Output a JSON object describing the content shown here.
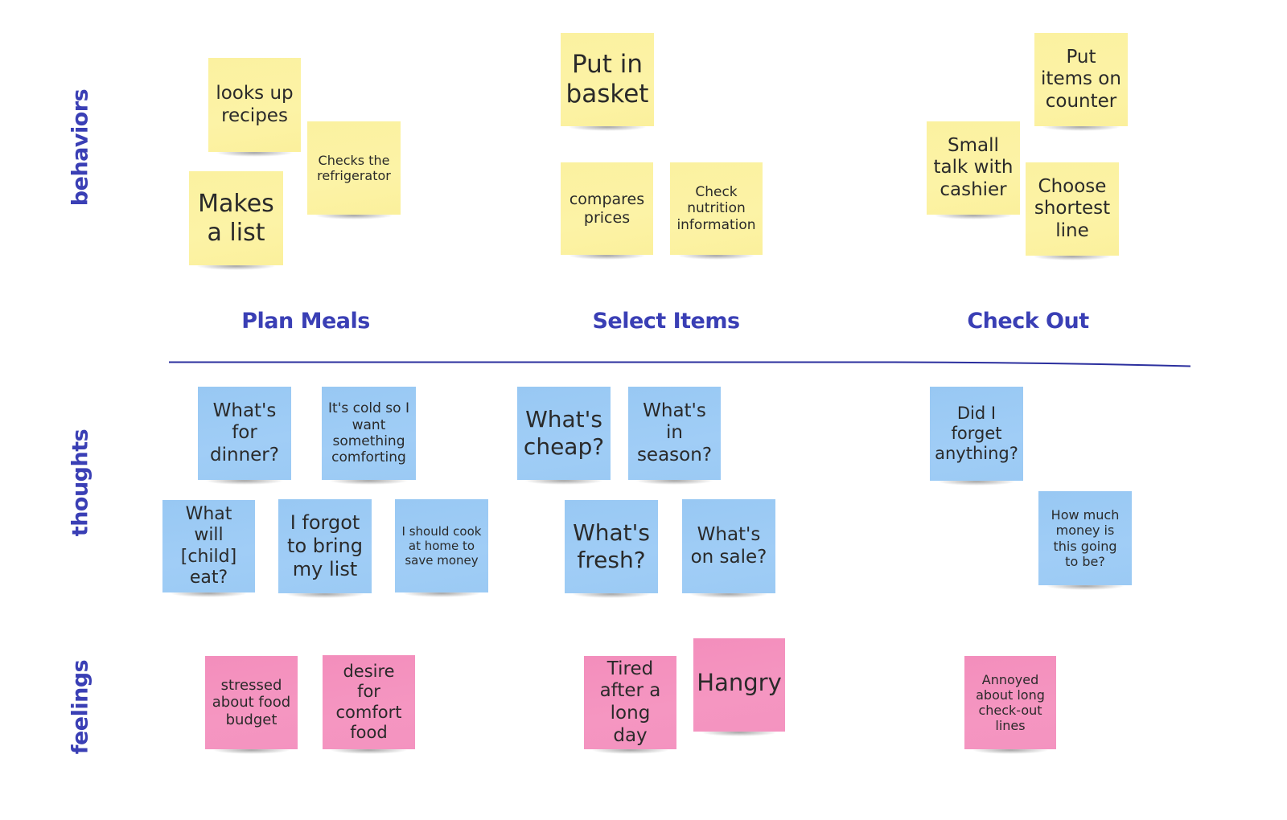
{
  "row_labels": {
    "behaviors": "behaviors",
    "thoughts": "thoughts",
    "feelings": "feelings"
  },
  "stages": [
    "Plan Meals",
    "Select Items",
    "Check Out"
  ],
  "colors": {
    "label": "#3a3fb5",
    "behavior_note": "#fcf3a6",
    "thought_note": "#a0cdf6",
    "feeling_note": "#f596c1"
  },
  "notes": {
    "behaviors": [
      {
        "stage": "Plan Meals",
        "text": "looks up recipes"
      },
      {
        "stage": "Plan Meals",
        "text": "Checks the refrigerator"
      },
      {
        "stage": "Plan Meals",
        "text": "Makes a list"
      },
      {
        "stage": "Select Items",
        "text": "Put in basket"
      },
      {
        "stage": "Select Items",
        "text": "compares prices"
      },
      {
        "stage": "Select Items",
        "text": "Check nutrition information"
      },
      {
        "stage": "Check Out",
        "text": "Put items on counter"
      },
      {
        "stage": "Check Out",
        "text": "Small talk with cashier"
      },
      {
        "stage": "Check Out",
        "text": "Choose shortest line"
      }
    ],
    "thoughts": [
      {
        "stage": "Plan Meals",
        "text": "What's for dinner?"
      },
      {
        "stage": "Plan Meals",
        "text": "It's cold so I want something comforting"
      },
      {
        "stage": "Plan Meals",
        "text": "What will [child] eat?"
      },
      {
        "stage": "Plan Meals",
        "text": "I forgot to bring my list"
      },
      {
        "stage": "Plan Meals",
        "text": "I should cook at home to save money"
      },
      {
        "stage": "Select Items",
        "text": "What's cheap?"
      },
      {
        "stage": "Select Items",
        "text": "What's in season?"
      },
      {
        "stage": "Select Items",
        "text": "What's fresh?"
      },
      {
        "stage": "Select Items",
        "text": "What's on sale?"
      },
      {
        "stage": "Check Out",
        "text": "Did I forget anything?"
      },
      {
        "stage": "Check Out",
        "text": "How much money is this going to be?"
      }
    ],
    "feelings": [
      {
        "stage": "Plan Meals",
        "text": "stressed about food budget"
      },
      {
        "stage": "Plan Meals",
        "text": "desire for comfort food"
      },
      {
        "stage": "Select Items",
        "text": "Tired after a long day"
      },
      {
        "stage": "Select Items",
        "text": "Hangry"
      },
      {
        "stage": "Check Out",
        "text": "Annoyed about long check-out lines"
      }
    ]
  }
}
